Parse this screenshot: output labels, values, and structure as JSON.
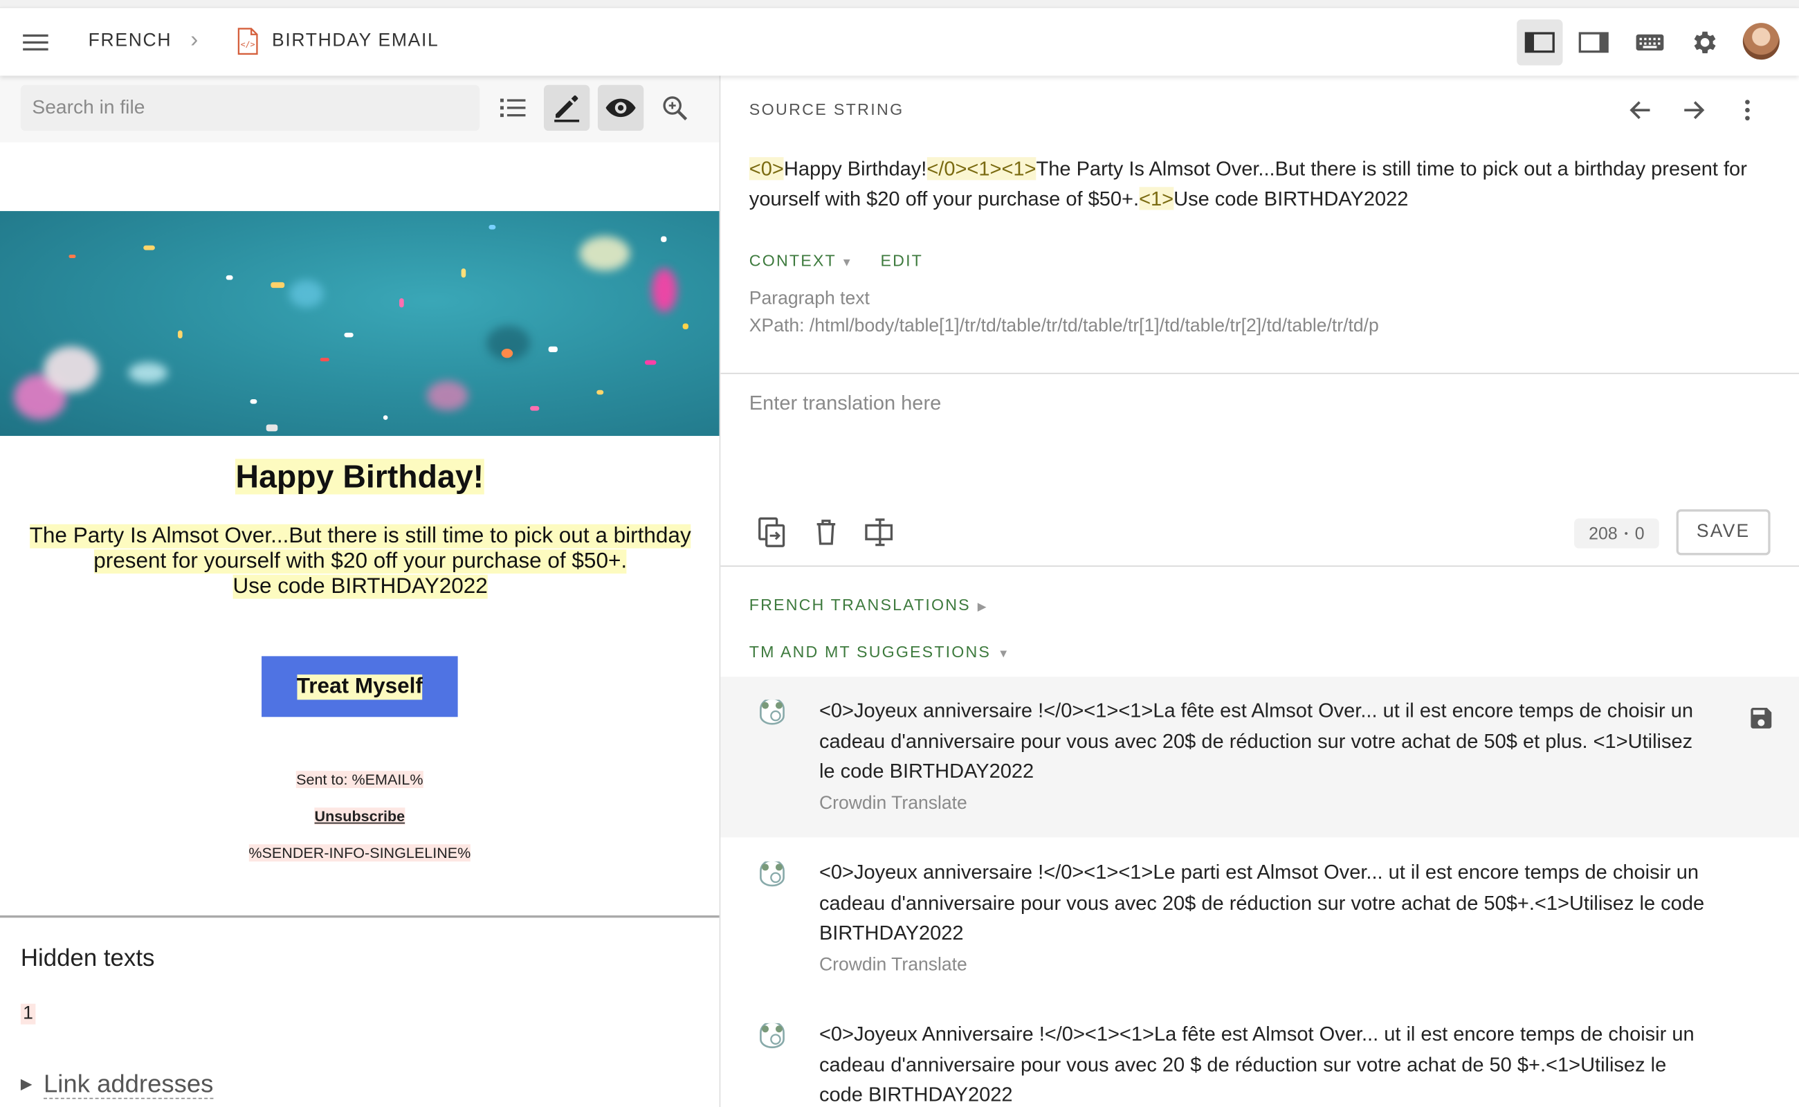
{
  "header": {
    "language": "FRENCH",
    "file_name": "BIRTHDAY EMAIL"
  },
  "left": {
    "search_placeholder": "Search in file",
    "email": {
      "title": "Happy Birthday!",
      "body_line1": "The Party Is Almsot Over...But there is still time to pick out a birthday",
      "body_line2": "present for yourself with $20 off your purchase of $50+.",
      "body_line3": "Use code BIRTHDAY2022",
      "cta": "Treat Myself",
      "sent_to": "Sent to: %EMAIL%",
      "unsubscribe": "Unsubscribe",
      "sender_info": "%SENDER-INFO-SINGLELINE%"
    },
    "hidden_texts_title": "Hidden texts",
    "hidden_texts_value": "1",
    "link_addresses": "Link addresses"
  },
  "right": {
    "source_label": "SOURCE STRING",
    "source": {
      "t1": "<0>",
      "s1": "Happy Birthday!",
      "t2": "</0><1><1>",
      "s2": "The Party Is Almsot Over...But there is still time to pick out a birthday present for yourself with $20 off your purchase of $50+.",
      "t3": "<1>",
      "s3": "Use code BIRTHDAY2022"
    },
    "context_label": "CONTEXT",
    "edit_label": "EDIT",
    "context_text": "Paragraph text",
    "context_xpath": "XPath: /html/body/table[1]/tr/td/table/tr/td/table/tr[1]/td/table/tr[2]/td/table/tr/td/p",
    "translation_placeholder": "Enter translation here",
    "counter_left": "208",
    "counter_right": "0",
    "save_label": "SAVE",
    "french_translations_label": "FRENCH TRANSLATIONS",
    "tm_mt_label": "TM AND MT SUGGESTIONS",
    "suggestions": [
      {
        "text": "<0>Joyeux anniversaire !</0><1><1>La fête est Almsot Over... ut il est encore temps de choisir un cadeau d'anniversaire pour vous avec 20$ de réduction sur votre achat de 50$ et plus. <1>Utilisez le code BIRTHDAY2022",
        "source": "Crowdin Translate"
      },
      {
        "text": "<0>Joyeux anniversaire !</0><1><1>Le parti est Almsot Over... ut il est encore temps de choisir un cadeau d'anniversaire pour vous avec 20$ de réduction sur votre achat de 50$+.<1>Utilisez le code BIRTHDAY2022",
        "source": "Crowdin Translate"
      },
      {
        "text": "<0>Joyeux Anniversaire !</0><1><1>La fête est Almsot Over... ut il est encore temps de choisir un cadeau d'anniversaire pour vous avec 20 $ de réduction sur votre achat de 50 $+.<1>Utilisez le code BIRTHDAY2022",
        "source": ""
      }
    ]
  },
  "colors": {
    "accent_green": "#3d7a3d",
    "tag_highlight": "#fbf6d2",
    "email_highlight": "#fdfbc0",
    "cta_blue": "#4f73e3"
  },
  "icons": [
    "menu-icon",
    "chevron-right-icon",
    "html-file-icon",
    "layout-left-icon",
    "layout-right-icon",
    "keyboard-icon",
    "gear-icon",
    "list-icon",
    "pencil-icon",
    "eye-icon",
    "zoom-icon",
    "arrow-left-icon",
    "arrow-right-icon",
    "more-vert-icon",
    "copy-source-icon",
    "trash-icon",
    "split-icon",
    "engine-icon",
    "save-icon"
  ]
}
